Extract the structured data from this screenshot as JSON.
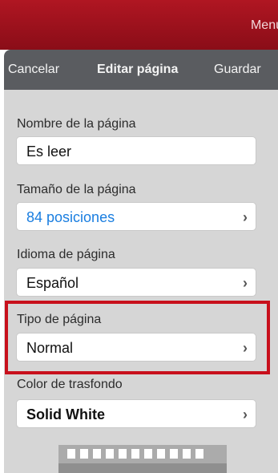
{
  "header": {
    "menu_label": "Menú"
  },
  "nav": {
    "cancel_label": "Cancelar",
    "title": "Editar página",
    "save_label": "Guardar"
  },
  "form": {
    "page_name": {
      "label": "Nombre de la página",
      "value": "Es leer"
    },
    "page_size": {
      "label": "Tamaño de la página",
      "value": "84 posiciones"
    },
    "page_language": {
      "label": "Idioma de página",
      "value": "Español"
    },
    "page_type": {
      "label": "Tipo de página",
      "value": "Normal"
    },
    "background_color": {
      "label": "Color de trasfondo",
      "value": "Solid White"
    }
  },
  "chevron_glyph": "›",
  "colors": {
    "header_red": "#a0121d",
    "navbar_gray": "#5a5c60",
    "link_blue": "#1a7ee0",
    "highlight_red": "#c8101c"
  }
}
